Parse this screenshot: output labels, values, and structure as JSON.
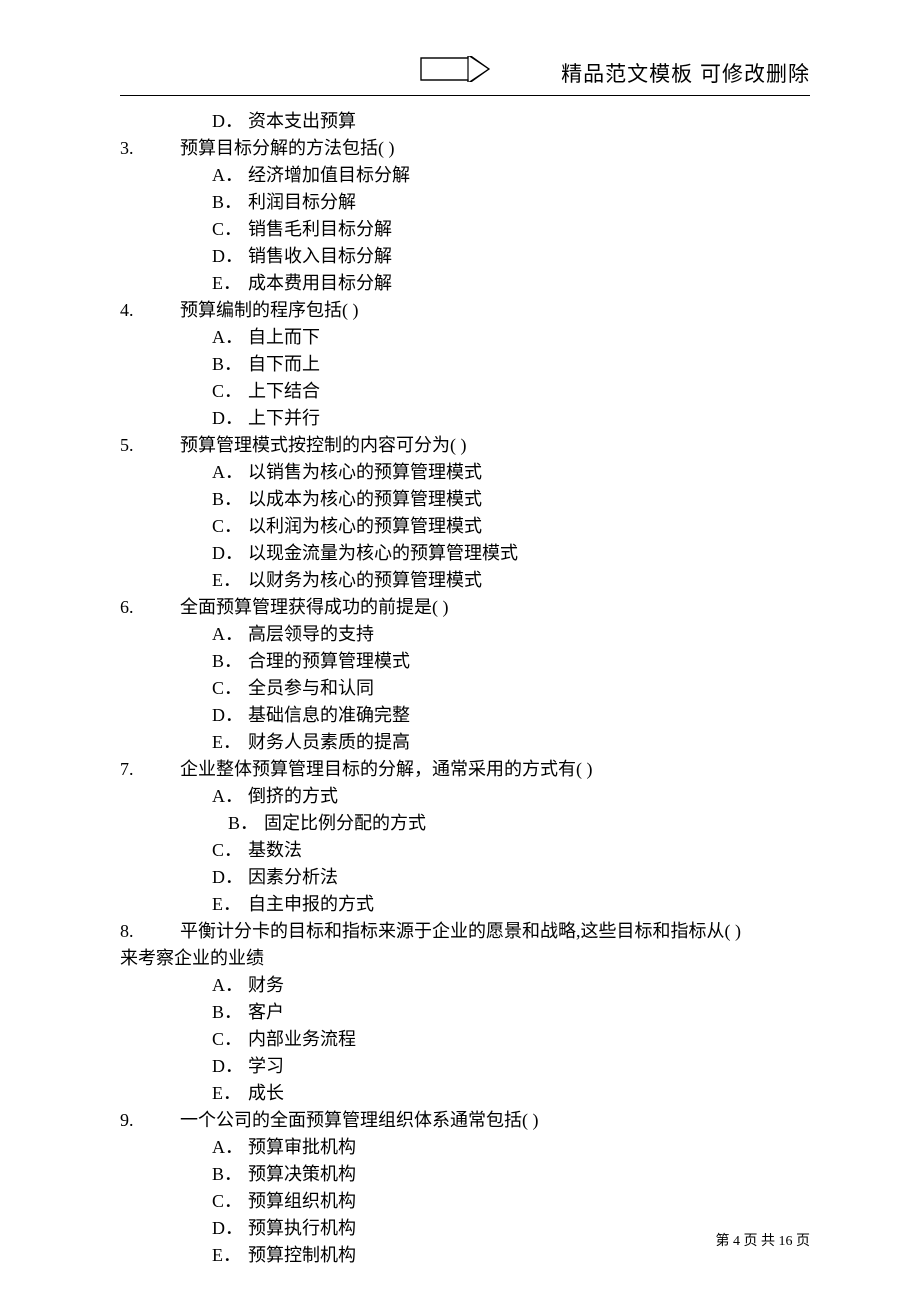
{
  "header": {
    "title": "精品范文模板  可修改删除"
  },
  "leadingOption": {
    "label": "D．",
    "text": "资本支出预算"
  },
  "questions": [
    {
      "num": "3.",
      "stem": "预算目标分解的方法包括( )",
      "options": [
        {
          "label": "A．",
          "text": "经济增加值目标分解"
        },
        {
          "label": "B．",
          "text": "利润目标分解"
        },
        {
          "label": "C．",
          "text": "销售毛利目标分解"
        },
        {
          "label": "D．",
          "text": "销售收入目标分解"
        },
        {
          "label": "E．",
          "text": "成本费用目标分解"
        }
      ]
    },
    {
      "num": "4.",
      "stem": "预算编制的程序包括( )",
      "options": [
        {
          "label": "A．",
          "text": "自上而下"
        },
        {
          "label": "B．",
          "text": "自下而上"
        },
        {
          "label": "C．",
          "text": "上下结合"
        },
        {
          "label": "D．",
          "text": "上下并行"
        }
      ]
    },
    {
      "num": "5.",
      "stem": "预算管理模式按控制的内容可分为( )",
      "options": [
        {
          "label": "A．",
          "text": "以销售为核心的预算管理模式"
        },
        {
          "label": "B．",
          "text": "以成本为核心的预算管理模式"
        },
        {
          "label": "C．",
          "text": "以利润为核心的预算管理模式"
        },
        {
          "label": "D．",
          "text": "以现金流量为核心的预算管理模式"
        },
        {
          "label": "E．",
          "text": "以财务为核心的预算管理模式"
        }
      ]
    },
    {
      "num": "6.",
      "stem": "全面预算管理获得成功的前提是( )",
      "options": [
        {
          "label": "A．",
          "text": "高层领导的支持"
        },
        {
          "label": "B．",
          "text": "合理的预算管理模式"
        },
        {
          "label": "C．",
          "text": "全员参与和认同"
        },
        {
          "label": "D．",
          "text": "基础信息的准确完整"
        },
        {
          "label": "E．",
          "text": "财务人员素质的提高"
        }
      ]
    },
    {
      "num": "7.",
      "stem": "企业整体预算管理目标的分解，通常采用的方式有( )",
      "options": [
        {
          "label": "A．",
          "text": "倒挤的方式"
        },
        {
          "label": "B．",
          "text": "固定比例分配的方式",
          "extraIndent": true
        },
        {
          "label": "C．",
          "text": "基数法"
        },
        {
          "label": "D．",
          "text": "因素分析法"
        },
        {
          "label": "E．",
          "text": "自主申报的方式"
        }
      ]
    },
    {
      "num": "8.",
      "stem": "平衡计分卡的目标和指标来源于企业的愿景和战略,这些目标和指标从( )",
      "stemCont": "来考察企业的业绩",
      "options": [
        {
          "label": "A．",
          "text": "财务"
        },
        {
          "label": "B．",
          "text": "客户"
        },
        {
          "label": "C．",
          "text": "内部业务流程"
        },
        {
          "label": "D．",
          "text": "学习"
        },
        {
          "label": "E．",
          "text": "成长"
        }
      ]
    },
    {
      "num": "9.",
      "stem": "一个公司的全面预算管理组织体系通常包括( )",
      "options": [
        {
          "label": "A．",
          "text": "预算审批机构"
        },
        {
          "label": "B．",
          "text": "预算决策机构"
        },
        {
          "label": "C．",
          "text": "预算组织机构"
        },
        {
          "label": "D．",
          "text": "预算执行机构"
        },
        {
          "label": "E．",
          "text": "预算控制机构"
        }
      ]
    }
  ],
  "footer": {
    "prefix": "第",
    "page": "4",
    "mid": "页 共",
    "total": "16",
    "suffix": "页"
  }
}
